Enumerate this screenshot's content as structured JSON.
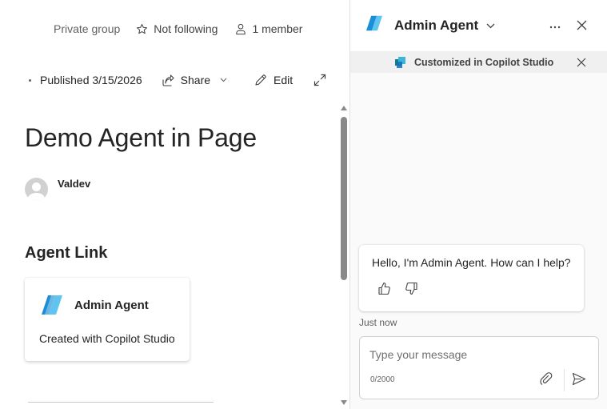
{
  "group_bar": {
    "privacy": "Private group",
    "follow": "Not following",
    "members": "1 member"
  },
  "command_bar": {
    "published": "Published 3/15/2026",
    "share": "Share",
    "edit": "Edit"
  },
  "page": {
    "title": "Demo Agent in Page",
    "author": "Valdev",
    "section_title": "Agent Link"
  },
  "agent_card": {
    "name": "Admin Agent",
    "description": "Created with Copilot Studio"
  },
  "copilot_pane": {
    "agent_name": "Admin Agent",
    "banner": "Customized in Copilot Studio",
    "message": "Hello, I'm Admin Agent. How can I help?",
    "timestamp": "Just now",
    "input_placeholder": "Type your message",
    "char_count": "0/2000"
  },
  "colors": {
    "logo_blue": "#1b8fd6",
    "logo_light": "#5fc4f0",
    "cs_teal": "#0f7d8a",
    "scroll_thumb": "#8a8a8a"
  },
  "icons": {
    "follow": "star-icon",
    "members": "person-icon",
    "share": "share-icon",
    "edit": "pencil-icon",
    "expand": "expand-icon",
    "more": "more-icon",
    "close": "close-icon",
    "like": "thumbs-up-icon",
    "dislike": "thumbs-down-icon",
    "attach": "paperclip-icon",
    "send": "send-icon"
  }
}
